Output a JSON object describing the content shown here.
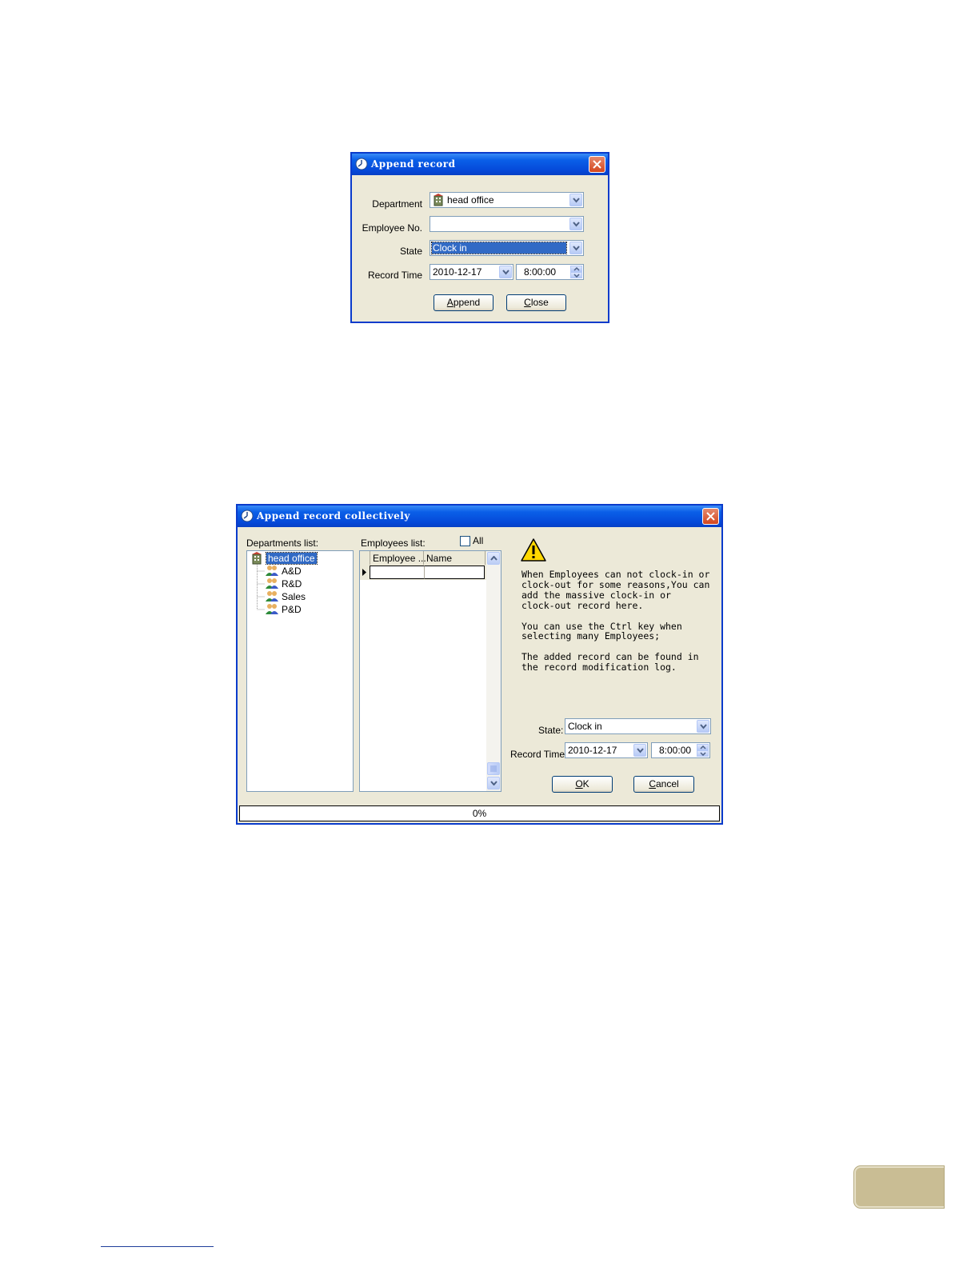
{
  "dialog1": {
    "title": "Append record",
    "department_label": "Department",
    "department_value": "head office",
    "employee_no_label": "Employee No.",
    "employee_no_value": "",
    "state_label": "State",
    "state_value": "Clock in",
    "record_time_label": "Record Time",
    "date_value": "2010-12-17",
    "time_value": "8:00:00",
    "append_prefix": "",
    "append_accel": "A",
    "append_rest": "ppend",
    "close_accel": "C",
    "close_rest": "lose"
  },
  "dialog2": {
    "title": "Append record collectively",
    "departments_label": "Departments list:",
    "employees_label": "Employees list:",
    "all_label": "All",
    "departments": [
      {
        "label": "head office"
      },
      {
        "label": "A&D"
      },
      {
        "label": "R&D"
      },
      {
        "label": "Sales"
      },
      {
        "label": "P&D"
      }
    ],
    "columns": [
      "Employee ...",
      "Name"
    ],
    "info_text": "When Employees can not clock-in or\nclock-out for some reasons,You can\nadd the massive clock-in or\nclock-out record here.\n\nYou can use the Ctrl key when\nselecting many Employees;\n\nThe added record can be found in\nthe record modification log.",
    "state_label": "State:",
    "state_value": "Clock in",
    "record_time_label": "Record Time:",
    "date_value": "2010-12-17",
    "time_value": "8:00:00",
    "ok_accel": "O",
    "ok_rest": "K",
    "cancel_accel": "C",
    "cancel_rest": "ancel",
    "progress": "0%"
  }
}
